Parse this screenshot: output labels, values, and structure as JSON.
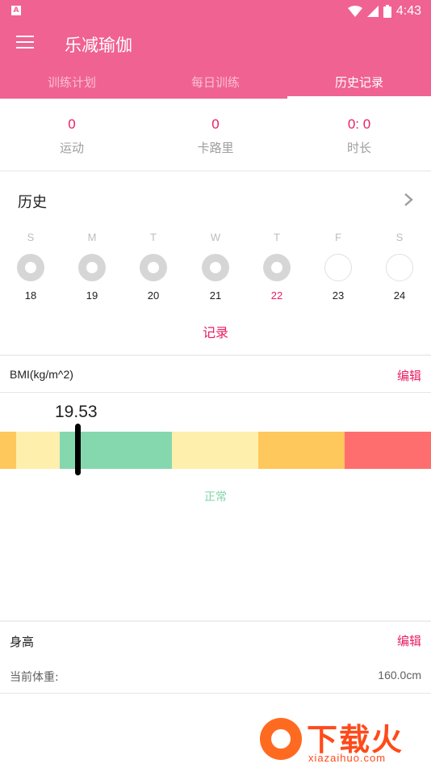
{
  "status_bar": {
    "time": "4:43",
    "notification_letter": "A"
  },
  "app": {
    "title": "乐减瑜伽"
  },
  "tabs": [
    {
      "label": "训练计划"
    },
    {
      "label": "每日训练"
    },
    {
      "label": "历史记录",
      "active": true
    }
  ],
  "stats": [
    {
      "value": "0",
      "label": "运动"
    },
    {
      "value": "0",
      "label": "卡路里"
    },
    {
      "value": "0: 0",
      "label": "时长"
    }
  ],
  "history": {
    "title": "历史",
    "days": [
      {
        "letter": "S",
        "date": "18",
        "done": true
      },
      {
        "letter": "M",
        "date": "19",
        "done": true
      },
      {
        "letter": "T",
        "date": "20",
        "done": true
      },
      {
        "letter": "W",
        "date": "21",
        "done": true
      },
      {
        "letter": "T",
        "date": "22",
        "done": true,
        "today": true
      },
      {
        "letter": "F",
        "date": "23",
        "done": false
      },
      {
        "letter": "S",
        "date": "24",
        "done": false
      }
    ],
    "record_link": "记录"
  },
  "bmi": {
    "label": "BMI(kg/m^2)",
    "edit": "编辑",
    "value": "19.53",
    "status": "正常",
    "colors": [
      "#ffc85c",
      "#ffefad",
      "#85d8ad",
      "#ffefad",
      "#ffc85c",
      "#ff6e6e"
    ]
  },
  "height": {
    "label": "身高",
    "edit": "编辑",
    "weight_label": "当前体重:",
    "value": "160.0cm"
  },
  "watermark": {
    "brand": "下载火",
    "site": "xiazaihuo.com"
  }
}
